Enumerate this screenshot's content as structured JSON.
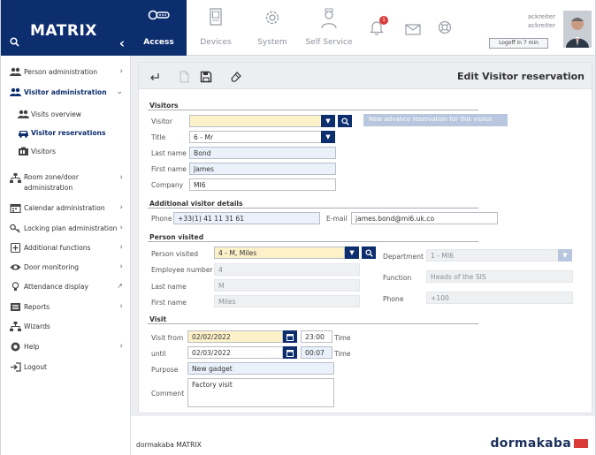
{
  "brand": {
    "title": "MATRIX"
  },
  "topnav": {
    "items": [
      {
        "label": "Access"
      },
      {
        "label": "Devices"
      },
      {
        "label": "System"
      },
      {
        "label": "Self Service"
      }
    ],
    "notification_count": "1",
    "user_line1": "ackreiter",
    "user_line2": "ackreiter",
    "logoff": "Logoff in 7 min"
  },
  "sidebar": {
    "items": [
      {
        "label": "Person administration"
      },
      {
        "label": "Visitor administration"
      },
      {
        "label": "Visits overview"
      },
      {
        "label": "Visitor reservations"
      },
      {
        "label": "Visitors"
      },
      {
        "label": "Room zone/door administration"
      },
      {
        "label": "Calendar administration"
      },
      {
        "label": "Locking plan administration"
      },
      {
        "label": "Additional functions"
      },
      {
        "label": "Door monitoring"
      },
      {
        "label": "Attendance display"
      },
      {
        "label": "Reports"
      },
      {
        "label": "Wizards"
      },
      {
        "label": "Help"
      },
      {
        "label": "Logout"
      }
    ]
  },
  "page": {
    "title": "Edit Visitor reservation"
  },
  "visitors": {
    "section": "Visitors",
    "visitor_label": "Visitor",
    "visitor_value": "",
    "new_reservation": "New advance reservation for this visitor",
    "title_label": "Title",
    "title_value": "6 - Mr",
    "last_name_label": "Last name",
    "last_name_value": "Bond",
    "first_name_label": "First name",
    "first_name_value": "James",
    "company_label": "Company",
    "company_value": "MI6"
  },
  "additional": {
    "section": "Additional visitor details",
    "phone_label": "Phone",
    "phone_value": "+33(1) 41 11 31 61",
    "email_label": "E-mail",
    "email_value": "james.bond@mi6.uk.co"
  },
  "person_visited": {
    "section": "Person visited",
    "person_label": "Person visited",
    "person_value": "4 - M, Miles",
    "employee_number_label": "Employee number",
    "employee_number_value": "4",
    "last_name_label": "Last name",
    "last_name_value": "M",
    "first_name_label": "First name",
    "first_name_value": "Miles",
    "department_label": "Department",
    "department_value": "1 - MI6",
    "function_label": "Function",
    "function_value": "Heads of the SIS",
    "phone_label": "Phone",
    "phone_value": "+100"
  },
  "visit": {
    "section": "Visit",
    "from_label": "Visit from",
    "from_date": "02/02/2022",
    "from_time": "23:00",
    "until_label": "until",
    "until_date": "02/03/2022",
    "until_time": "00:07",
    "time_label": "Time",
    "purpose_label": "Purpose",
    "purpose_value": "New gadget",
    "comment_label": "Comment",
    "comment_value": "Factory visit"
  },
  "footer": {
    "left": "dormakaba MATRIX",
    "logo": "dormakaba"
  }
}
